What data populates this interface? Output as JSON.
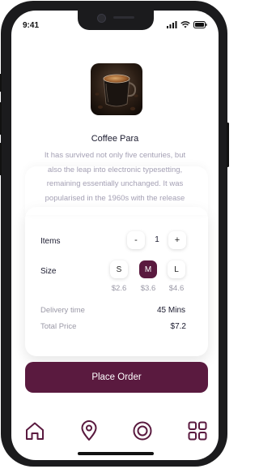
{
  "status_bar": {
    "time": "9:41",
    "icons": [
      "signal-icon",
      "wifi-icon",
      "battery-icon"
    ]
  },
  "product": {
    "image": "coffee-cup-image",
    "title": "Coffee Para",
    "description": "It has survived not only five centuries, but also the leap into electronic typesetting, remaining essentially unchanged. It was popularised in the 1960s with the release"
  },
  "order": {
    "items_label": "Items",
    "decrement_label": "-",
    "quantity": "1",
    "increment_label": "+",
    "size_label": "Size",
    "sizes": [
      {
        "label": "S",
        "price": "$2.6",
        "selected": false
      },
      {
        "label": "M",
        "price": "$3.6",
        "selected": true
      },
      {
        "label": "L",
        "price": "$4.6",
        "selected": false
      }
    ],
    "delivery_label": "Delivery time",
    "delivery_value": "45 Mins",
    "total_label": "Total Price",
    "total_value": "$7.2",
    "place_order_label": "Place Order"
  },
  "nav": {
    "items": [
      "home-icon",
      "location-pin-icon",
      "target-icon",
      "grid-icon"
    ]
  },
  "colors": {
    "accent": "#5a1a3f",
    "muted_text": "#9a98a6",
    "description_text": "#a4a0b4",
    "dark_text": "#1a1a2e"
  }
}
